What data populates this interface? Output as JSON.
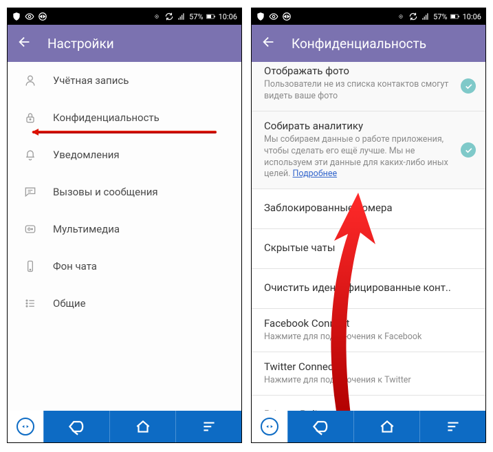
{
  "status": {
    "battery_pct": "57%",
    "time": "10:06"
  },
  "left": {
    "title": "Настройки",
    "items": [
      {
        "label": "Учётная запись"
      },
      {
        "label": "Конфиденциальность",
        "highlighted": true
      },
      {
        "label": "Уведомления"
      },
      {
        "label": "Вызовы и сообщения"
      },
      {
        "label": "Мультимедиа"
      },
      {
        "label": "Фон чата"
      },
      {
        "label": "Общие"
      }
    ]
  },
  "right": {
    "title": "Конфиденциальность",
    "items": [
      {
        "title": "Отображать фото",
        "sub": "Пользователи не из списка контактов смогут видеть ваше фото",
        "toggle": true
      },
      {
        "title": "Собирать аналитику",
        "sub": "Мы собираем данные о работе приложения, чтобы сделать его ещё лучше. Мы не используем эти данные для каких-либо иных целей.",
        "link": "Подробнее",
        "toggle": true
      },
      {
        "title": "Заблокированные номера"
      },
      {
        "title": "Скрытые чаты"
      },
      {
        "title": "Очистить идентифицированные конт.."
      },
      {
        "title": "Facebook Connect",
        "sub": "Нажмите для подключения к Facebook"
      },
      {
        "title": "Twitter Connect",
        "sub": "Нажмите для подключения к Twitter"
      },
      {
        "title": "Privacy Policy"
      }
    ]
  }
}
